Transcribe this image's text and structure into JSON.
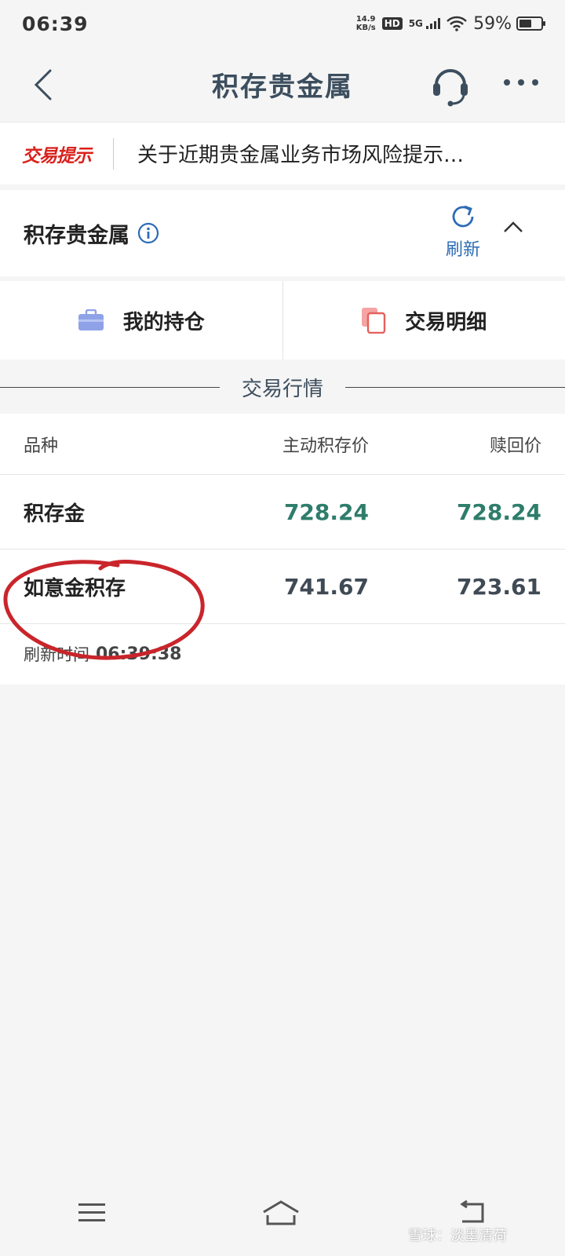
{
  "status_bar": {
    "time": "06:39",
    "net_speed_value": "14.9",
    "net_speed_unit": "KB/s",
    "hd": "HD",
    "signal": "5G",
    "battery": "59%",
    "battery_level": 0.59
  },
  "nav": {
    "title": "积存贵金属",
    "back_icon": "chevron-left-icon",
    "service_icon": "headset-icon",
    "more_icon": "more-dots-icon"
  },
  "notice": {
    "tag": "交易提示",
    "text": "关于近期贵金属业务市场风险提示…"
  },
  "section": {
    "title": "积存贵金属",
    "refresh_label": "刷新"
  },
  "quick_actions": [
    {
      "label": "我的持仓",
      "icon": "briefcase-icon"
    },
    {
      "label": "交易明细",
      "icon": "documents-icon"
    }
  ],
  "market": {
    "divider_label": "交易行情",
    "columns": [
      "品种",
      "主动积存价",
      "赎回价"
    ],
    "rows": [
      {
        "name": "积存金",
        "active_price": "728.24",
        "redeem_price": "728.24"
      },
      {
        "name": "如意金积存",
        "active_price": "741.67",
        "redeem_price": "723.61"
      }
    ],
    "refresh_time_label": "刷新时间",
    "refresh_time": "06:39:38"
  },
  "bottom_nav": {
    "menu_icon": "menu-icon",
    "home_icon": "home-icon",
    "back_icon": "back-arrow-icon"
  },
  "watermark": "雪球：淡墨清荷",
  "colors": {
    "nav_title": "#3c4e5e",
    "notice_tag": "#d9211c",
    "accent_blue": "#2d6cb5",
    "price_green": "#2e7d6b",
    "price_gray": "#3f4a55",
    "annotation_red": "#c9252b"
  }
}
